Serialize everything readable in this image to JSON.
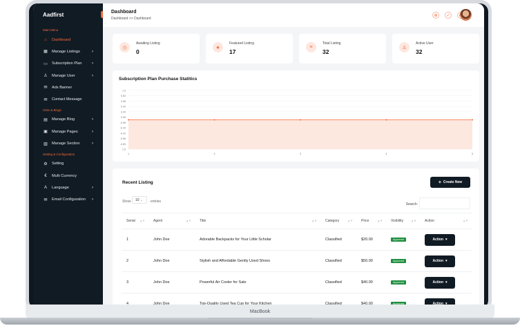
{
  "brand": "Aadfirst",
  "sidebar": {
    "sections": [
      {
        "title": "Main Menu",
        "items": [
          {
            "label": "Dashboard",
            "icon": "home-icon",
            "active": true,
            "chevron": false
          },
          {
            "label": "Manage Listings",
            "icon": "grid-icon",
            "chevron": true
          },
          {
            "label": "Subscription Plan",
            "icon": "card-icon",
            "chevron": true
          },
          {
            "label": "Manage User",
            "icon": "user-icon",
            "chevron": true
          },
          {
            "label": "Ads Banner",
            "icon": "megaphone-icon",
            "chevron": false
          },
          {
            "label": "Contact Message",
            "icon": "mail-icon",
            "chevron": false
          }
        ]
      },
      {
        "title": "CMS & Blogs",
        "items": [
          {
            "label": "Manage Blog",
            "icon": "blog-icon",
            "chevron": true
          },
          {
            "label": "Manage Pages",
            "icon": "pages-icon",
            "chevron": true
          },
          {
            "label": "Manage Section",
            "icon": "section-icon",
            "chevron": true
          }
        ]
      },
      {
        "title": "Setting & Configuration",
        "items": [
          {
            "label": "Setting",
            "icon": "gear-icon",
            "chevron": false
          },
          {
            "label": "Multi Currency",
            "icon": "euro-icon",
            "chevron": false
          },
          {
            "label": "Language",
            "icon": "language-icon",
            "chevron": true
          },
          {
            "label": "Email Configuration",
            "icon": "email-config-icon",
            "chevron": true
          }
        ]
      }
    ]
  },
  "header": {
    "title": "Dashboard",
    "breadcrumb": "Dashboard >> Dashboard"
  },
  "stats": [
    {
      "label": "Awaiting Listing",
      "value": "0",
      "icon": "clock-icon"
    },
    {
      "label": "Featured Listing",
      "value": "17",
      "icon": "star-icon"
    },
    {
      "label": "Total Listing",
      "value": "32",
      "icon": "list-icon"
    },
    {
      "label": "Active User",
      "value": "32",
      "icon": "user-icon"
    }
  ],
  "chart_data": {
    "type": "area",
    "title": "Subscription Plan Purchase Statitics",
    "x": [
      "1",
      "2",
      "3",
      "4",
      "5"
    ],
    "y_ticks": [
      "1.5",
      "0.83",
      "0.58",
      "0.42",
      "0.25",
      "0.08",
      "-0.08",
      "-0.25",
      "-0.42",
      "-0.58",
      "-0.83",
      "1.5"
    ],
    "series": [
      {
        "values": [
          0,
          0,
          0,
          0,
          0
        ],
        "color": "#f26a3b"
      }
    ],
    "ylim": [
      -1,
      1
    ]
  },
  "recent": {
    "title": "Recent Listing",
    "create_label": "Create New",
    "show_label": "Show",
    "show_value": "10",
    "entries_label": "entries",
    "search_label": "Search:",
    "columns": [
      "Serial",
      "Agent",
      "Title",
      "Category",
      "Price",
      "Visibility",
      "Action"
    ],
    "rows": [
      {
        "serial": "1",
        "agent": "John Doe",
        "title": "Adorable Backpacks for Your Little Scholar",
        "category": "Classified",
        "price": "$20.00",
        "visibility": "Approved",
        "action": "Action"
      },
      {
        "serial": "2",
        "agent": "John Doe",
        "title": "Stylish and Affordable Gently Used Shoes",
        "category": "Classified",
        "price": "$50.00",
        "visibility": "Approved",
        "action": "Action"
      },
      {
        "serial": "3",
        "agent": "John Doe",
        "title": "Powerful Air Cooler for Sale",
        "category": "Classified",
        "price": "$40.00",
        "visibility": "Approved",
        "action": "Action"
      },
      {
        "serial": "4",
        "agent": "John Doe",
        "title": "Top-Quality Used Tea Cup for Your Kitchen",
        "category": "Classified",
        "price": "$40.00",
        "visibility": "Approved",
        "action": "Action"
      }
    ]
  },
  "device_label": "MacBook",
  "colors": {
    "accent": "#f26a3b",
    "sidebar": "#111b24",
    "success": "#1e8e3e"
  }
}
